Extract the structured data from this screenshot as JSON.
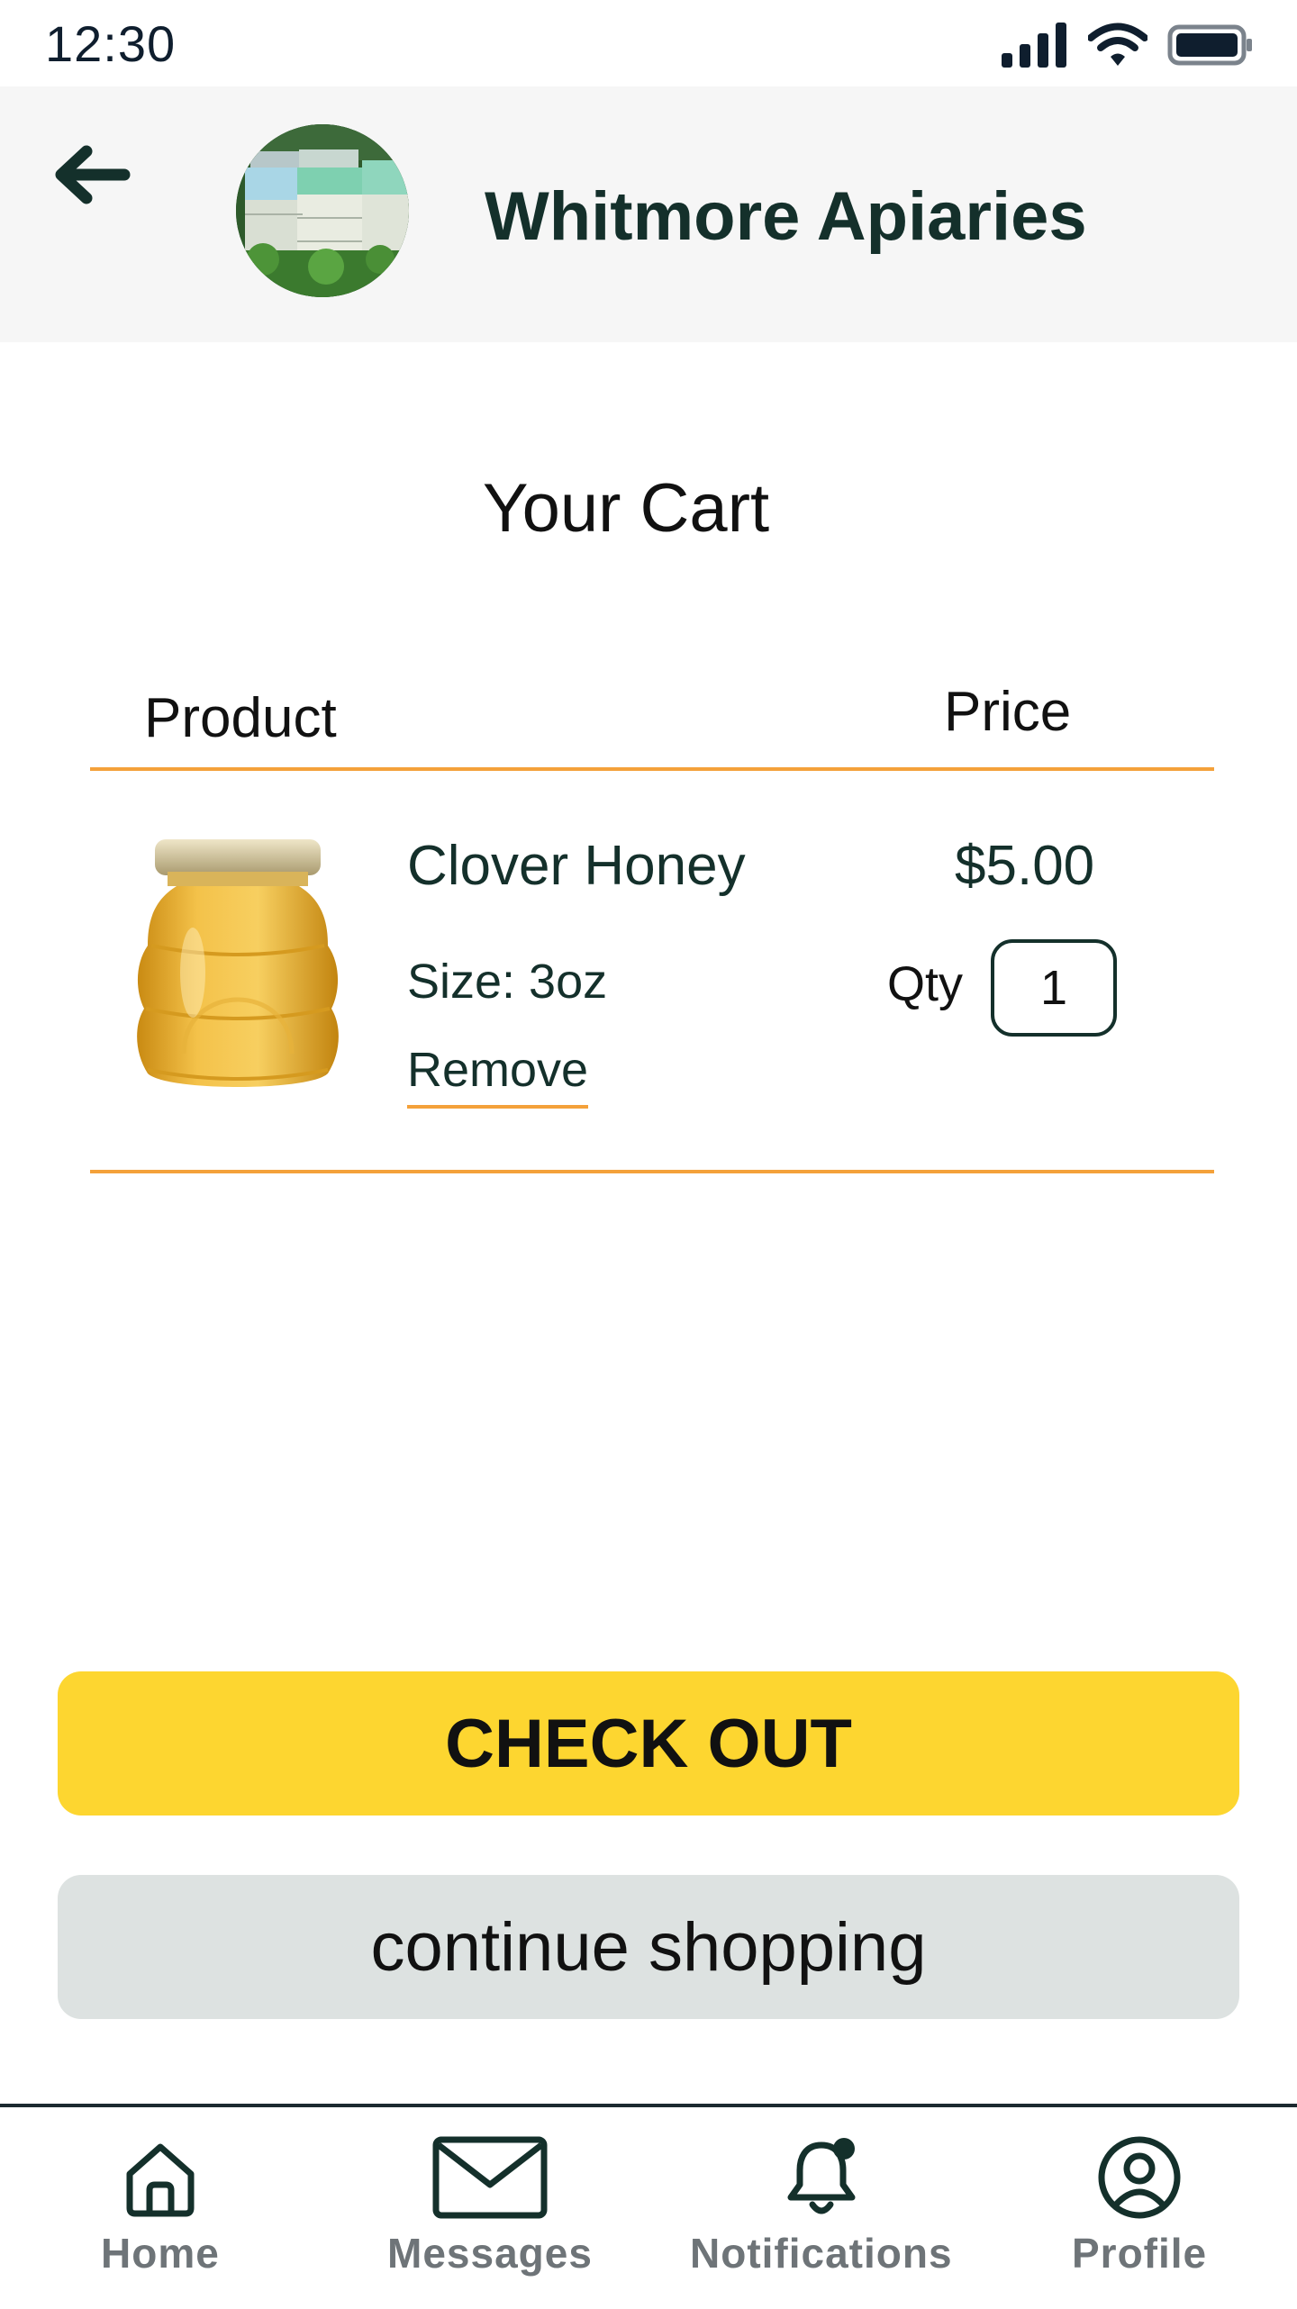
{
  "status_bar": {
    "time": "12:30",
    "icons": [
      "signal-icon",
      "wifi-icon",
      "battery-icon"
    ]
  },
  "header": {
    "back_icon": "arrow-left-icon",
    "shop_name": "Whitmore Apiaries",
    "avatar": "beehive-photo"
  },
  "cart": {
    "title": "Your Cart",
    "columns": {
      "product": "Product",
      "price": "Price"
    },
    "items": [
      {
        "name": "Clover Honey",
        "size": "Size: 3oz",
        "remove_label": "Remove",
        "price": "$5.00",
        "qty_label": "Qty",
        "qty": "1",
        "image": "honey-jar-image"
      }
    ]
  },
  "actions": {
    "checkout_label": "CHECK OUT",
    "continue_label": "continue shopping"
  },
  "bottom_nav": {
    "items": [
      {
        "label": "Home",
        "icon": "home-icon"
      },
      {
        "label": "Messages",
        "icon": "envelope-icon"
      },
      {
        "label": "Notifications",
        "icon": "bell-icon"
      },
      {
        "label": "Profile",
        "icon": "profile-icon"
      }
    ]
  },
  "colors": {
    "accent_orange": "#f4a13a",
    "checkout_yellow": "#fdd630",
    "secondary_gray": "#dde2e1",
    "header_bg": "#f6f6f6",
    "text_dark": "#14302b",
    "nav_label": "#6e7478"
  }
}
